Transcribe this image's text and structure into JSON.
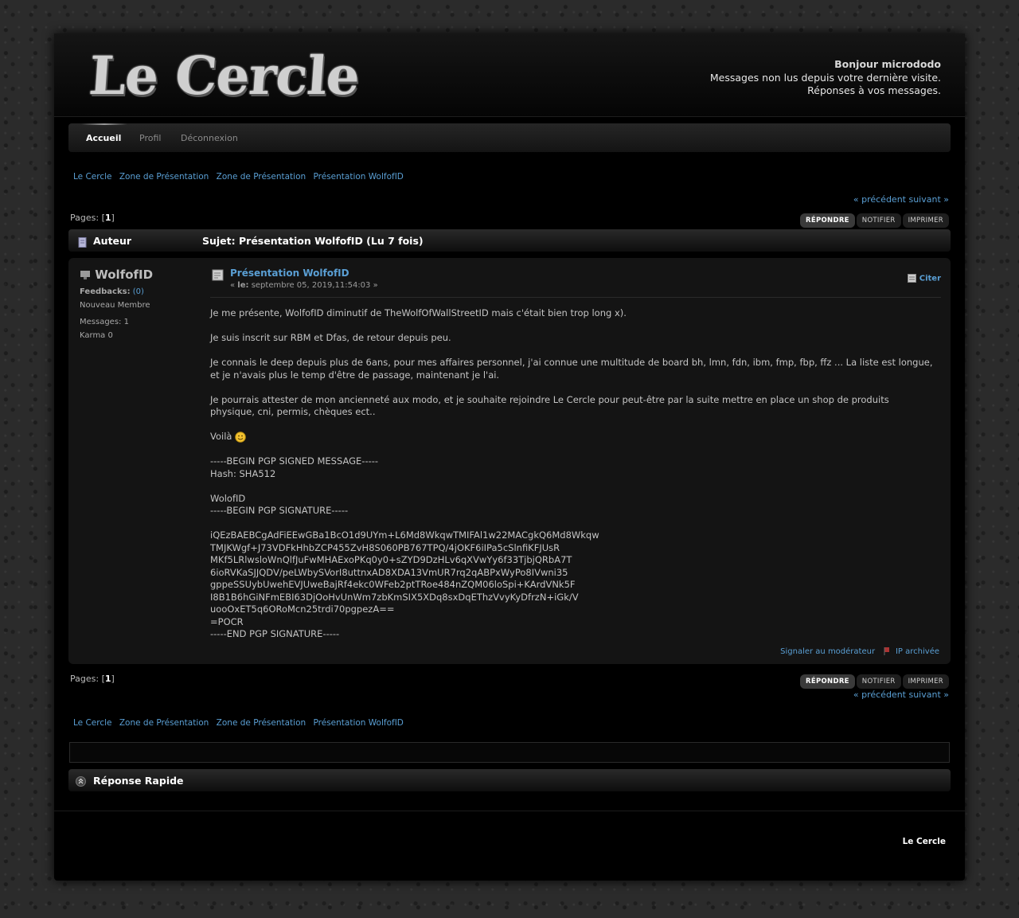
{
  "header": {
    "logo_text": "Le Cercle",
    "greeting": "Bonjour micrododo",
    "unread_link": "Messages non lus depuis votre dernière visite.",
    "replies_link": "Réponses à vos messages."
  },
  "menu": {
    "items": [
      "Accueil",
      "Profil",
      "Déconnexion"
    ]
  },
  "linktree": [
    "Le Cercle",
    "Zone de Présentation",
    "Zone de Présentation",
    "Présentation WolfofID"
  ],
  "nav": {
    "prev_next": "« précédent suivant »"
  },
  "pages": {
    "label": "Pages:",
    "current": "1"
  },
  "buttons": {
    "reply": "RÉPONDRE",
    "notify": "NOTIFIER",
    "print": "IMPRIMER"
  },
  "catbar": {
    "author": "Auteur",
    "topic": "Sujet: Présentation WolfofID  (Lu 7 fois)"
  },
  "post": {
    "author": "WolfofID",
    "feedbacks_label": "Feedbacks:",
    "feedbacks_value": "(0)",
    "rank": "Nouveau Membre",
    "messages": "Messages: 1",
    "karma": "Karma 0",
    "subject": "Présentation WolfofID",
    "date_prefix": "« ",
    "date_label": "le:",
    "date": " septembre 05, 2019,11:54:03 »",
    "quote": "Citer",
    "paragraphs": [
      "Je me présente, WolfofID diminutif de TheWolfOfWallStreetID mais c'était bien trop long x).",
      "Je suis inscrit sur RBM et Dfas, de retour depuis peu.",
      "Je connais le deep depuis plus de 6ans, pour mes affaires personnel, j'ai connue une multitude de board bh, lmn, fdn, ibm, fmp, fbp, ffz ... La liste est longue, et je n'avais plus le temp d'être de passage, maintenant je l'ai.",
      "Je pourrais attester de mon ancienneté aux modo, et je souhaite rejoindre Le Cercle pour peut-être par la suite mettre en place un shop de produits physique, cni, permis, chèques ect..",
      "Voilà",
      "-----BEGIN PGP SIGNED MESSAGE-----\nHash: SHA512",
      "WolofID\n-----BEGIN PGP SIGNATURE-----",
      "iQEzBAEBCgAdFiEEwGBa1BcO1d9UYm+L6Md8WkqwTMIFAl1w22MACgkQ6Md8Wkqw\nTMJKWgf+J73VDFkHhbZCP455ZvH8S060PB767TPQ/4jOKF6iIPa5cSlnfiKFJUsR\nMKf5LRlwsloWnQlfJuFwMHAExoPKq0y0+sZYD9DzHLv6qXVwYy6f33TjbjQRbA7T\n6ioRVKaSJJQDV/peLWbySVorI8uttnxAD8XDA13VmUR7rq2qABPxWyPo8IVwni35\ngppeSSUybUwehEVJUweBajRf4ekc0WFeb2ptTRoe484nZQM06loSpi+KArdVNk5F\nI8B1B6hGiNFmEBI63DjOoHvUnWm7zbKmSIX5XDq8sxDqEThzVvyKyDfrzN+iGk/V\nuooOxET5q6ORoMcn25trdi70pgpezA==\n=POCR\n-----END PGP SIGNATURE-----"
    ],
    "report": "Signaler au modérateur",
    "ip": "IP archivée"
  },
  "quick_reply": {
    "title": "Réponse Rapide"
  },
  "footer": {
    "copyright": "Le Cercle"
  }
}
